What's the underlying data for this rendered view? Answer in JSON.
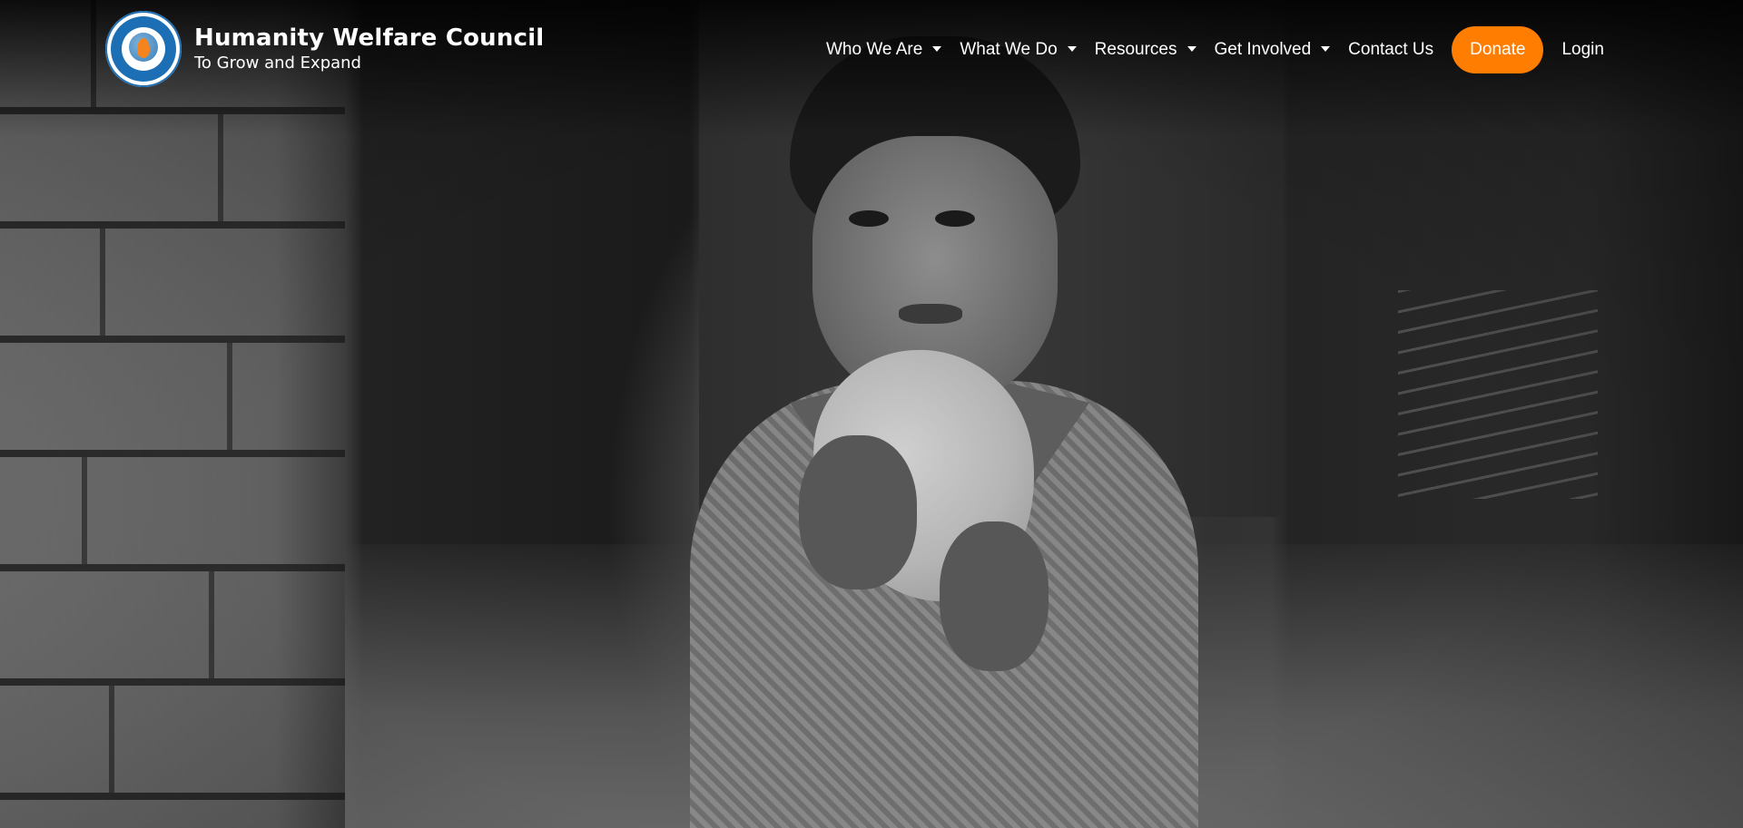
{
  "brand": {
    "title": "Humanity Welfare Council",
    "tagline": "To Grow and Expand",
    "logo_icon": "humanity-welfare-council-seal",
    "logo_text": "HUMANITY WELFARE COUNCIL"
  },
  "nav": {
    "items": [
      {
        "label": "Who We Are",
        "has_dropdown": true
      },
      {
        "label": "What We Do",
        "has_dropdown": true
      },
      {
        "label": "Resources",
        "has_dropdown": true
      },
      {
        "label": "Get Involved",
        "has_dropdown": true
      },
      {
        "label": "Contact Us",
        "has_dropdown": false
      }
    ],
    "donate_label": "Donate",
    "login_label": "Login"
  },
  "colors": {
    "accent": "#ff7d00",
    "logo_blue": "#1d6fb5",
    "text": "#ffffff"
  },
  "hero": {
    "image_subject": "child holding flatbread (black and white photo)"
  }
}
